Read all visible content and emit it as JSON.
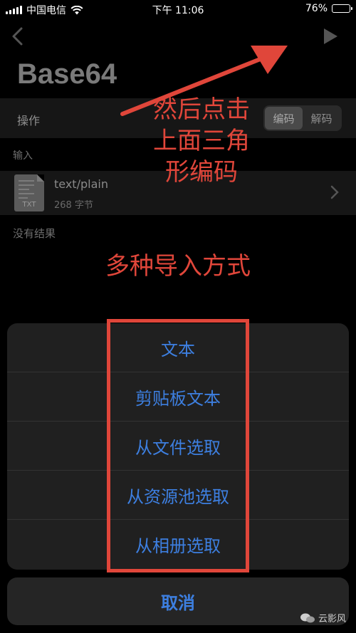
{
  "status_bar": {
    "carrier": "中国电信",
    "time": "下午 11:06",
    "battery": "76%",
    "battery_level": 0.76
  },
  "app": {
    "title": "Base64",
    "operations_label": "操作",
    "segments": [
      "编码",
      "解码"
    ],
    "active_segment": "编码",
    "input_section_label": "输入",
    "input_file": {
      "type": "text/plain",
      "size": "268 字节",
      "ext": "TXT"
    },
    "result_placeholder": "没有结果"
  },
  "annotations": {
    "note_top": [
      "然后点击",
      "上面三角",
      "形编码"
    ],
    "note_middle": "多种导入方式",
    "color": "#e0463a"
  },
  "action_sheet": {
    "items": [
      "文本",
      "剪贴板文本",
      "从文件选取",
      "从资源池选取",
      "从相册选取"
    ],
    "cancel": "取消"
  },
  "watermark": {
    "text": "云影风",
    "icon": "wechat-icon"
  },
  "colors": {
    "accent": "#3d7fe0",
    "annotation": "#e0463a"
  }
}
